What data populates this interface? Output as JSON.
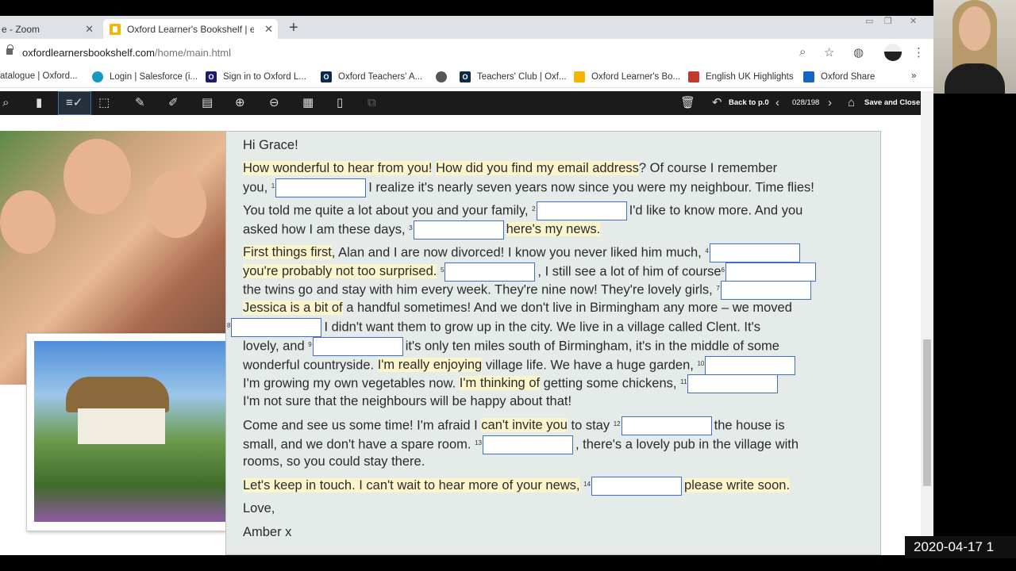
{
  "tabs": [
    {
      "title": "e - Zoom",
      "active": false
    },
    {
      "title": "Oxford Learner's Bookshelf | e-b",
      "active": true
    }
  ],
  "address": {
    "host": "oxfordlearnersbookshelf.com",
    "path": "/home/main.html"
  },
  "bookmarks": [
    "atalogue | Oxford...",
    "Login | Salesforce (i...",
    "Sign in to Oxford L...",
    "Oxford Teachers' A...",
    "Teachers' Club | Oxf...",
    "Oxford Learner's Bo...",
    "English UK Highlights",
    "Oxford Share"
  ],
  "reader": {
    "back_label": "Back to p.0",
    "page_count": "028/198",
    "save_close": "Save and Close"
  },
  "letter": {
    "greeting": "Hi Grace!",
    "l1a": "How wonderful to hear from you!",
    "l1b": "How did you find my email address",
    "l1c": "? Of course I remember",
    "l2a": "you,",
    "l2b": "I realize it's nearly seven years now since you were my neighbour. Time flies!",
    "l3a": "You told me quite a lot about you and your family,",
    "l3b": "I'd like to know more. And you",
    "l4a": "asked how I am these days,",
    "l4b": "here's my news.",
    "l5a": "First things first",
    "l5b": ", Alan and I are now divorced! I know you never liked him much,",
    "l6a": "you're probably not too surprised.",
    "l6b": ", I still see a lot of him of course",
    "l7a": "the twins go and stay with him every week. They're nine now! They're lovely girls,",
    "l8a": "Jessica is a bit of",
    "l8b": " a handful sometimes! And we don't live in Birmingham any more – we moved",
    "l9a": "I didn't want them to grow up in the city. We live in a village called Clent. It's",
    "l10a": "lovely, and",
    "l10b": "it's only ten miles south of Birmingham, it's in the middle of some",
    "l11a": "wonderful countryside.",
    "l11b": "I'm really enjoying",
    "l11c": " village life. We have a huge garden,",
    "l12a": "I'm growing my own vegetables now.",
    "l12b": "I'm thinking of",
    "l12c": " getting some chickens,",
    "l13a": "I'm not sure that the neighbours will be happy about that!",
    "l14a": "Come and see us some time! I'm afraid I",
    "l14b": "can't invite you",
    "l14c": " to stay",
    "l14d": "the house is",
    "l15a": "small, and we don't have a spare room.",
    "l15b": ", there's a lovely pub in the village with",
    "l16a": "rooms, so you could stay there.",
    "l17a": "Let's keep in touch. I can't wait to hear more of your news,",
    "l17b": "please write soon.",
    "love": "Love,",
    "sign": "Amber x",
    "nums": [
      "1",
      "2",
      "3",
      "4",
      "5",
      "6",
      "7",
      "8",
      "9",
      "10",
      "11",
      "12",
      "13",
      "14"
    ]
  },
  "timestamp": "2020-04-17 1",
  "colors": {
    "highlight": "#fbf5cc",
    "blank_border": "#3f6fc4",
    "letter_bg": "#e4ebe9",
    "toolbar": "#1b1b1b"
  }
}
